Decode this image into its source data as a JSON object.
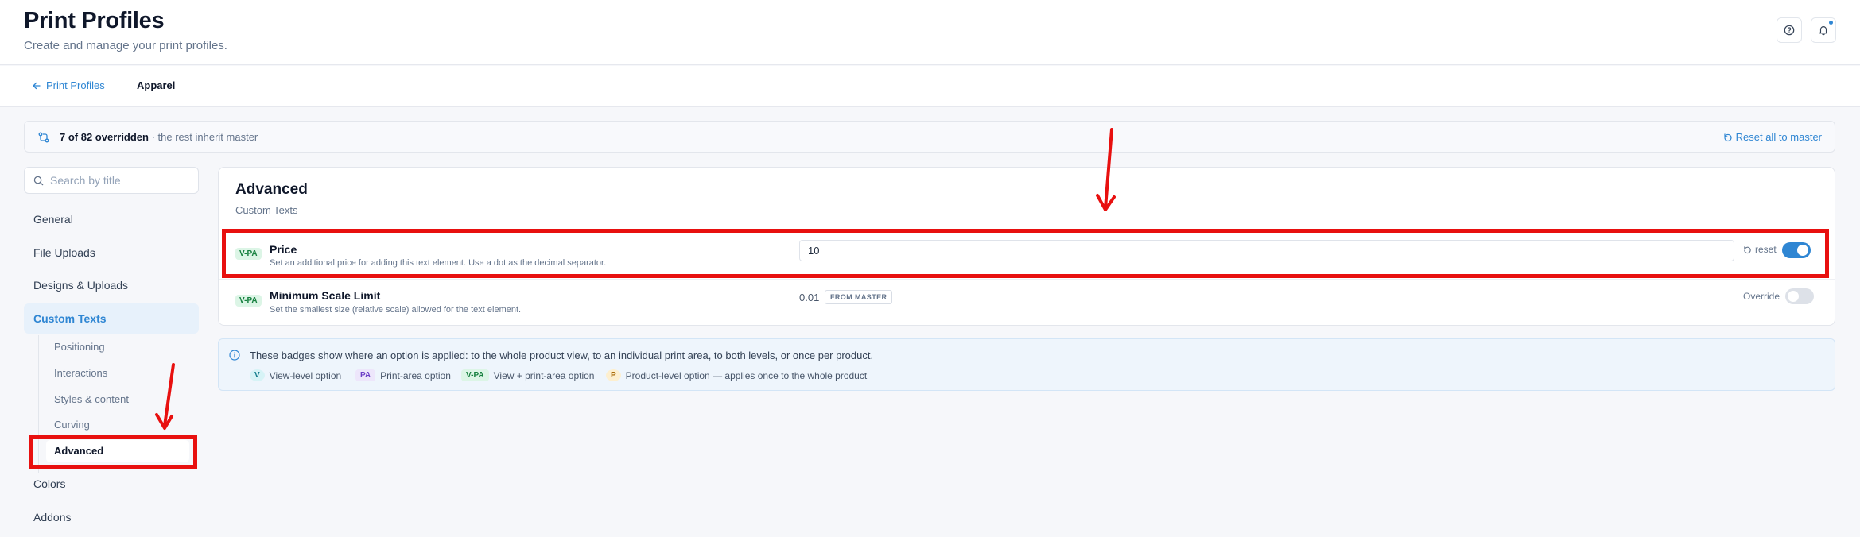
{
  "header": {
    "title": "Print Profiles",
    "subtitle": "Create and manage your print profiles."
  },
  "breadcrumb": {
    "back_label": "Print Profiles",
    "current": "Apparel"
  },
  "override_bar": {
    "count_text": "7 of 82 overridden",
    "rest_text": " · the rest inherit master",
    "reset_all_label": "Reset all to master"
  },
  "sidebar": {
    "search_placeholder": "Search by title",
    "items": [
      {
        "label": "General"
      },
      {
        "label": "File Uploads"
      },
      {
        "label": "Designs & Uploads"
      },
      {
        "label": "Custom Texts"
      },
      {
        "label": "Colors"
      },
      {
        "label": "Addons"
      }
    ],
    "subitems": [
      {
        "label": "Positioning"
      },
      {
        "label": "Interactions"
      },
      {
        "label": "Styles & content"
      },
      {
        "label": "Curving"
      },
      {
        "label": "Advanced"
      }
    ]
  },
  "section": {
    "title": "Advanced",
    "subtitle": "Custom Texts",
    "rows": [
      {
        "badge": "V-PA",
        "label": "Price",
        "description": "Set an additional price for adding this text element. Use a dot as the decimal separator.",
        "value": "10",
        "reset_label": "reset",
        "override_on": true
      },
      {
        "badge": "V-PA",
        "label": "Minimum Scale Limit",
        "description": "Set the smallest size (relative scale) allowed for the text element.",
        "value": "0.01",
        "source_tag": "FROM MASTER",
        "override_label": "Override",
        "override_on": false
      }
    ]
  },
  "info": {
    "text": "These badges show where an option is applied: to the whole product view, to an individual print area, to both levels, or once per product.",
    "legend": [
      {
        "badge": "V",
        "label": "View-level option"
      },
      {
        "badge": "PA",
        "label": "Print-area option"
      },
      {
        "badge": "V-PA",
        "label": "View + print-area option"
      },
      {
        "badge": "P",
        "label": "Product-level option — applies once to the whole product"
      }
    ]
  },
  "colors": {
    "accent": "#2f86d3",
    "annotation": "#e8100f"
  }
}
